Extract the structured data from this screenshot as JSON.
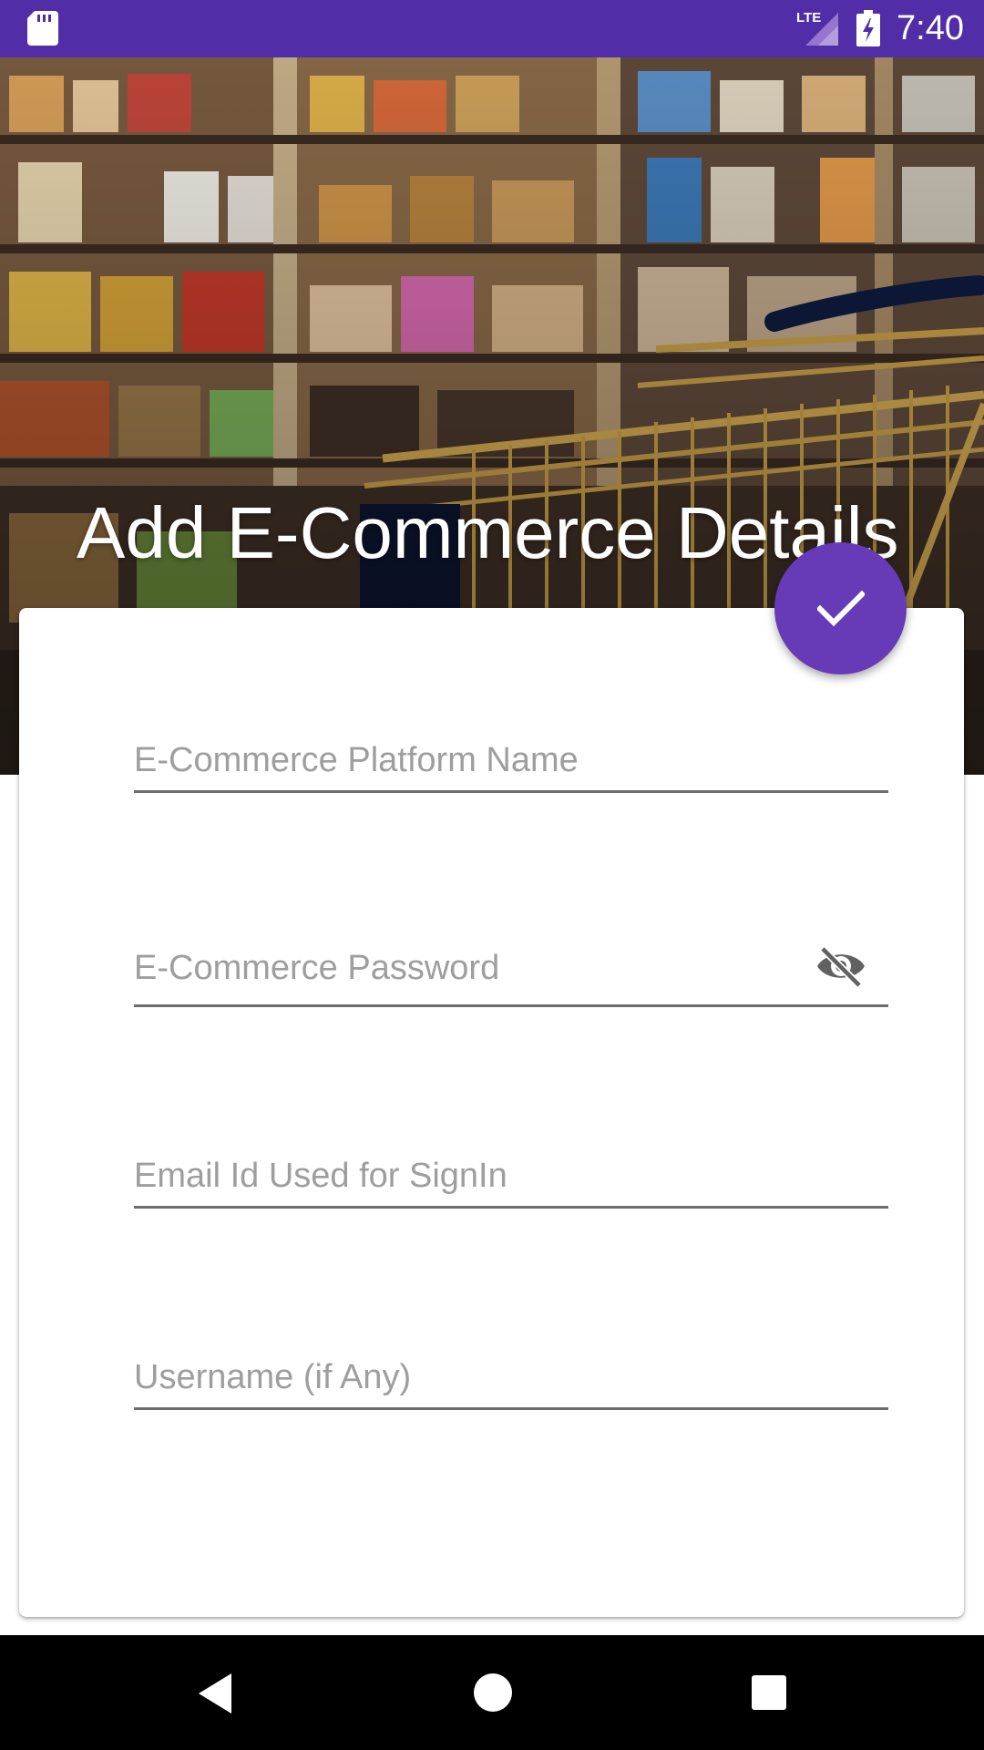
{
  "status_bar": {
    "time": "7:40",
    "network": "LTE",
    "background_color": "#512da8"
  },
  "header": {
    "title": "Add E-Commerce Details",
    "background_image": "supermarket-shopping-cart-photo"
  },
  "form": {
    "fields": [
      {
        "label": "E-Commerce Platform Name",
        "value": ""
      },
      {
        "label": "E-Commerce Password",
        "value": "",
        "trailing_icon": "visibility-off-icon"
      },
      {
        "label": "Email Id Used for SignIn",
        "value": ""
      },
      {
        "label": "Username (if Any)",
        "value": ""
      }
    ]
  },
  "fab": {
    "icon": "check-icon",
    "color": "#673ab7"
  },
  "nav_bar": {
    "back_icon": "back-triangle-icon",
    "home_icon": "home-circle-icon",
    "recents_icon": "recents-square-icon"
  }
}
